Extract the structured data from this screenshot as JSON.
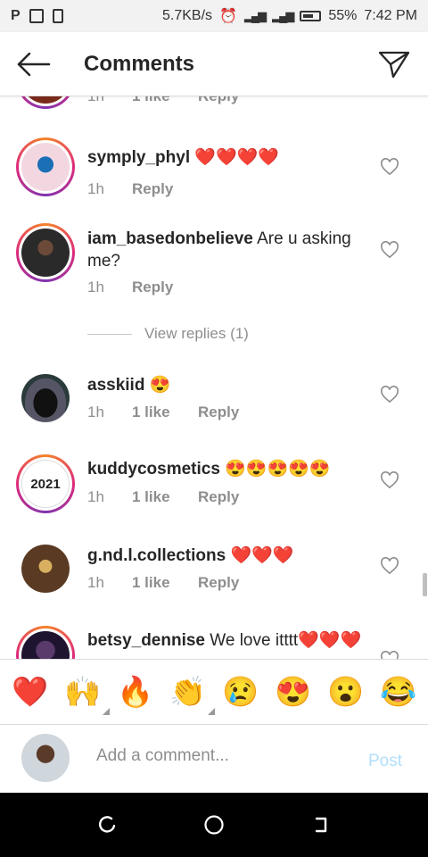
{
  "status_bar": {
    "net_speed": "5.7KB/s",
    "battery_pct": "55%",
    "time": "7:42 PM",
    "left_glyph": "P"
  },
  "header": {
    "title": "Comments"
  },
  "partial_row": {
    "time": "1h",
    "likes": "1 like",
    "reply": "Reply"
  },
  "comments": [
    {
      "user": "symply_phyl",
      "text": " ❤️❤️❤️❤️",
      "time": "1h",
      "likes": "",
      "reply": "Reply",
      "avatar": "butterfly"
    },
    {
      "user": "iam_basedonbelieve",
      "text": " Are u asking me?",
      "time": "1h",
      "likes": "",
      "reply": "Reply",
      "avatar": "man-dark"
    },
    {
      "user": "asskiid",
      "text": " 😍",
      "time": "1h",
      "likes": "1 like",
      "reply": "Reply",
      "avatar": "car"
    },
    {
      "user": "kuddycosmetics",
      "text": " 😍😍😍😍😍",
      "time": "1h",
      "likes": "1 like",
      "reply": "Reply",
      "avatar": "2021"
    },
    {
      "user": "g.nd.l.collections",
      "text": " ❤️❤️❤️",
      "time": "1h",
      "likes": "1 like",
      "reply": "Reply",
      "avatar": "logo"
    },
    {
      "user": "betsy_dennise",
      "text": " We love itttt❤️❤️❤️",
      "time": "",
      "likes": "",
      "reply": "",
      "avatar": "woman"
    }
  ],
  "view_replies": "View replies (1)",
  "avatar_2021_text": "2021",
  "emoji_bar": [
    "❤️",
    "🙌",
    "🔥",
    "👏",
    "😢",
    "😍",
    "😮",
    "😂"
  ],
  "add_comment": {
    "placeholder": "Add a comment...",
    "post_label": "Post"
  },
  "colors": {
    "post_disabled": "#b2dffc",
    "meta_gray": "#8e8e8e",
    "heart": "#e0245e"
  }
}
